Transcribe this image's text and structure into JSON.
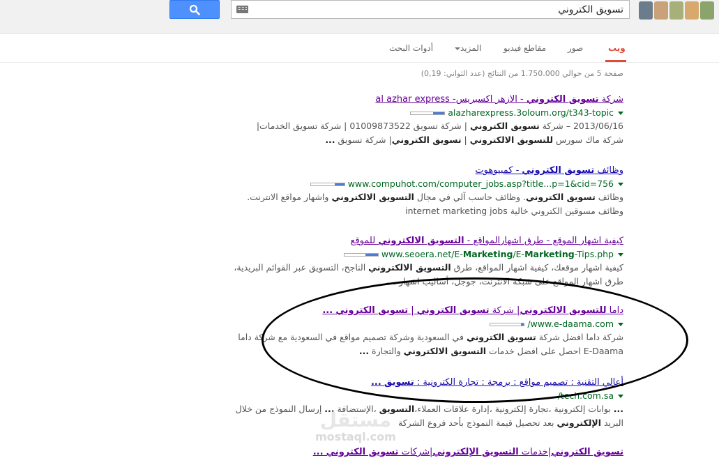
{
  "search": {
    "query": "تسويق الكتروني"
  },
  "tabs": [
    {
      "label": "ويب",
      "active": true
    },
    {
      "label": "صور"
    },
    {
      "label": "مقاطع فيديو"
    },
    {
      "label": "المزيد"
    },
    {
      "label": "أدوات البحث"
    }
  ],
  "stats": "صفحة 5 من حوالي 1.750.000 من النتائج (عدد الثواني: 0,19)",
  "results": [
    {
      "title": "شركة <b>تسويق الكتروني</b> - الازهر اكسبريس- al azhar express",
      "url": "alazharexpress.3oloum.org/t343-topic",
      "snippet": "2013/06/16 – شركة <b>تسويق الكتروني</b> | شركة تسويق 01009873522 | شركة تسويق الخدمات| شركة ماك سورس <b>للتسويق الالكتروني</b> | <b>تسويق الكتروني</b>| شركة تسويق <b>...</b>",
      "visited": true
    },
    {
      "title": "وظائف <b>تسويق الكتروني</b> - كمبيوهوت",
      "url": "www.compuhot.com/computer_jobs.asp?title...p=1&cid=756",
      "snippet": "وظائف <b>تسويق الكتروني</b>. وظائف حاسب آلي في مجال <b>التسويق الالكتروني</b> واشهار مواقع الانترنت. وظائف مسوقين الكتروني خالية internet marketing jobs",
      "visited": false
    },
    {
      "title": "كيفية اشهار الموقع - طرق اشهارالمواقع - <b>التسويق الالكتروني</b> للموقع",
      "url": "www.seoera.net/E-<b>Marketing</b>/E-<b>Marketing</b>-Tips.php",
      "snippet": "كيفية اشهار موقعك، كيفية اشهار المواقع، طرق <b>التسويق الالكتروني</b> الناجح، التسويق عبر القوائم البريدية، طرق اشهار المواقع على شبكة الانترنت، جوجل، أساليب اشهار <b>...</b>",
      "visited": true
    },
    {
      "title": "داما <b>للتسويق الالكتروني</b>| شركة <b>تسويق الكتروني</b> | <b>تسويق الكتروني</b> <b>...</b>",
      "url": "www.e-daama.com/",
      "snippet": "شركة داما افضل شركة <b>تسويق الكتروني</b> في السعودية وشركة تصميم مواقع في السعودية مع شركة داما E-Daama احصل على افضل خدمات <b>التسويق الالكتروني</b> والتجارة <b>...</b>",
      "visited": true
    },
    {
      "title": "أعالي التقنية : تصميم مواقع : برمجة : تجارة الكترونية : <b>تسويق</b> <b>...</b>",
      "url": "tech.com.sa/",
      "snippet": "<b>...</b> بوابات إلكترونية ،تجارة إلكترونية ،إدارة علاقات العملاء،<b>التسويق</b> ،الإستضافة <b>...</b> إرسال النموذج من خلال البريد <b>الإلكتروني</b> بعد تحصيل قيمة النموذج بأحد فروع الشركة",
      "visited": false
    },
    {
      "title": "<b>تسويق الكتروني</b>|خدمات <b>التسويق الإلكتروني</b>|شركات <b>تسويق الكتروني</b> <b>...</b>",
      "visited": true
    }
  ],
  "watermark": {
    "ar": "مستقل",
    "en": "mostaql.com"
  },
  "colors": {
    "search_button": "#4d90fe",
    "active_tab": "#dd4b39",
    "title_link": "#1a0dab",
    "title_visited": "#660099",
    "url_green": "#006621"
  }
}
